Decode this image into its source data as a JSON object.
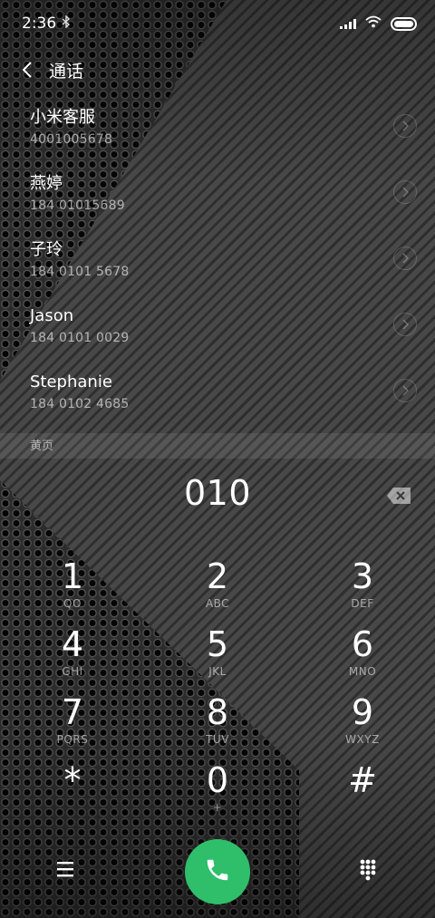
{
  "status": {
    "time": "2:36",
    "bluetooth_icon": "bluetooth-icon",
    "signal_icon": "signal-icon",
    "wifi_icon": "wifi-icon",
    "battery_icon": "battery-icon"
  },
  "header": {
    "back_icon": "back-arrow-icon",
    "title": "通话"
  },
  "contacts": [
    {
      "name": "小米客服",
      "number": "4001005678"
    },
    {
      "name": "燕婷",
      "number": "184 01015689"
    },
    {
      "name": "子玲",
      "number": "184 0101 5678"
    },
    {
      "name": "Jason",
      "number": "184 0101 0029"
    },
    {
      "name": "Stephanie",
      "number": "184 0102 4685"
    }
  ],
  "section": {
    "label": "黄页"
  },
  "dialer": {
    "input": "010",
    "backspace_icon": "backspace-icon"
  },
  "keypad": [
    {
      "digit": "1",
      "letters": "QO"
    },
    {
      "digit": "2",
      "letters": "ABC"
    },
    {
      "digit": "3",
      "letters": "DEF"
    },
    {
      "digit": "4",
      "letters": "GHI"
    },
    {
      "digit": "5",
      "letters": "JKL"
    },
    {
      "digit": "6",
      "letters": "MNO"
    },
    {
      "digit": "7",
      "letters": "PQRS"
    },
    {
      "digit": "8",
      "letters": "TUV"
    },
    {
      "digit": "9",
      "letters": "WXYZ"
    },
    {
      "digit": "*",
      "letters": ""
    },
    {
      "digit": "0",
      "letters": "+"
    },
    {
      "digit": "#",
      "letters": ""
    }
  ],
  "bottom": {
    "menu_icon": "menu-icon",
    "call_icon": "phone-icon",
    "dialpad_icon": "dialpad-icon"
  },
  "colors": {
    "call_button": "#2fbf6a",
    "text": "#ffffff",
    "secondary_text": "rgba(255,255,255,0.6)"
  }
}
